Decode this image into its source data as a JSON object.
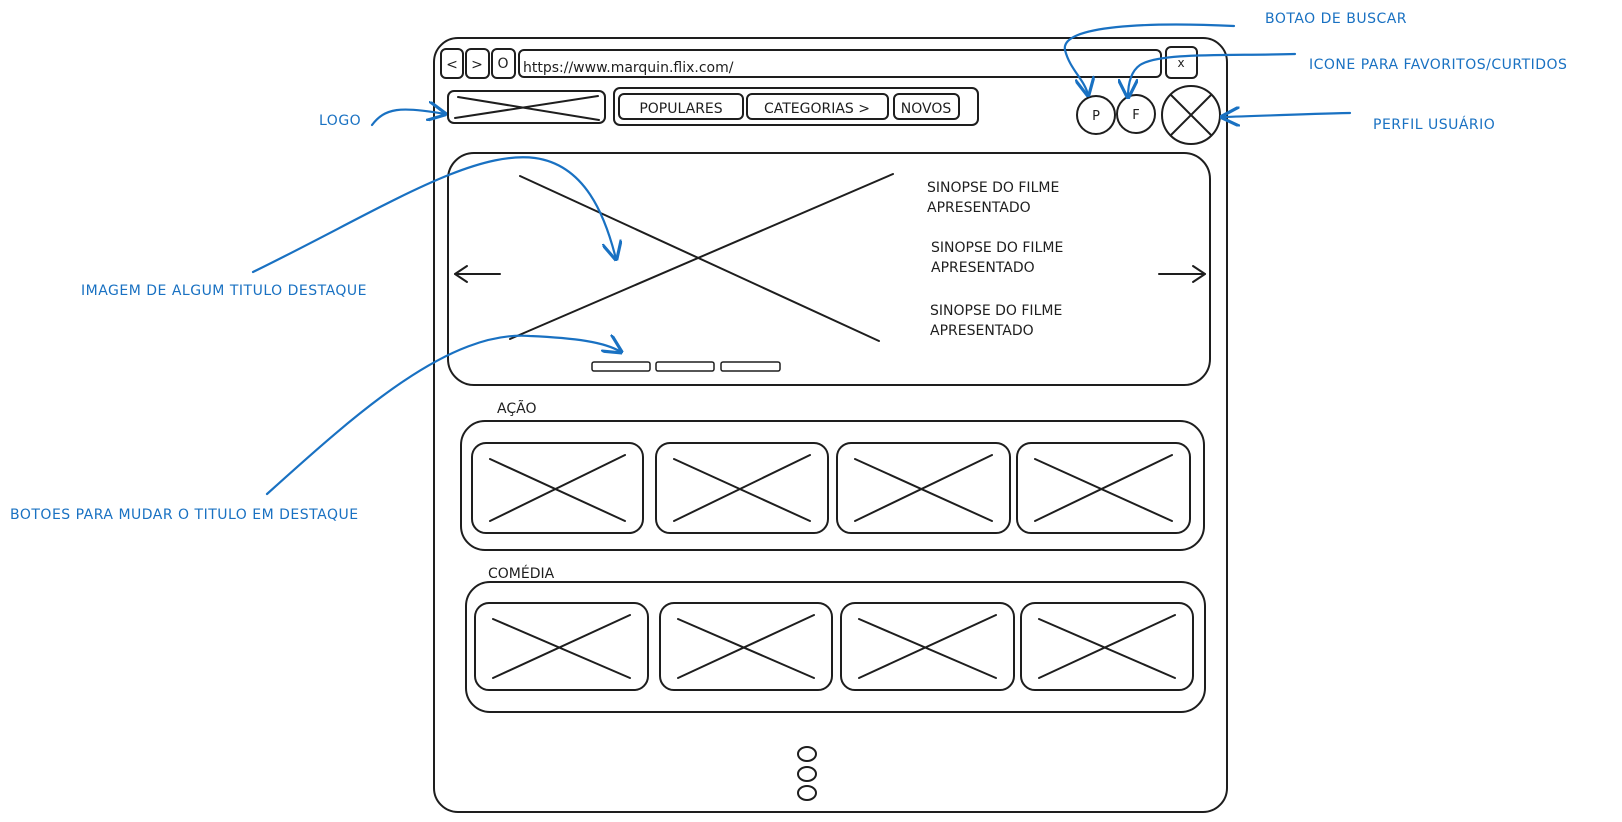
{
  "browser": {
    "back_label": "<",
    "forward_label": ">",
    "reload_label": "O",
    "url": "https://www.marquin.flix.com/",
    "close_label": "x"
  },
  "header": {
    "nav": [
      "POPULARES",
      "CATEGORIAS >",
      "NOVOS"
    ],
    "search_label": "P",
    "favorites_label": "F"
  },
  "hero": {
    "synopsis": [
      [
        "SINOPSE DO FILME",
        "APRESENTADO"
      ],
      [
        "SINOPSE DO FILME",
        "APRESENTADO"
      ],
      [
        "SINOPSE DO FILME",
        "APRESENTADO"
      ]
    ],
    "slide_count": 3
  },
  "rows": [
    {
      "title": "AÇÃO",
      "cards": 4
    },
    {
      "title": "COMÉDIA",
      "cards": 4
    }
  ],
  "annotations": {
    "logo": "LOGO",
    "hero_image": "IMAGEM DE ALGUM TITULO DESTAQUE",
    "hero_buttons": "BOTOES PARA MUDAR O TITULO EM DESTAQUE",
    "search": "BOTAO DE BUSCAR",
    "favorites": "ICONE PARA FAVORITOS/CURTIDOS",
    "profile": "PERFIL USUÁRIO"
  },
  "colors": {
    "ink": "#1e1e1e",
    "annotation": "#1971c2",
    "background": "#ffffff"
  }
}
